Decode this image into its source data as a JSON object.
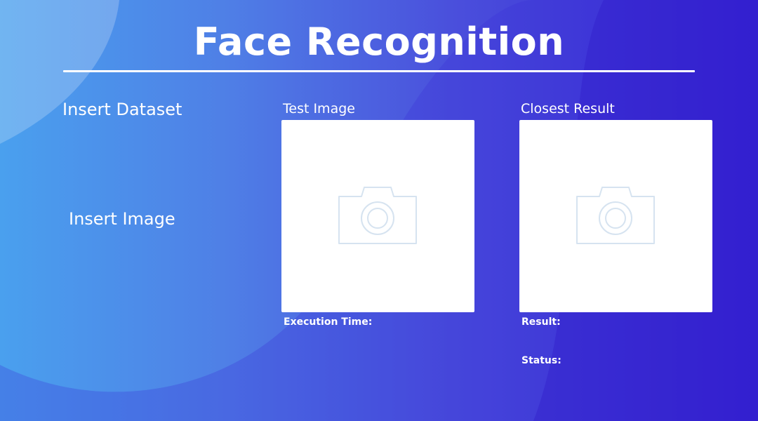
{
  "app": {
    "title": "Face Recognition"
  },
  "controls": {
    "insert_dataset_label": "Insert Dataset",
    "insert_image_label": "Insert Image"
  },
  "panels": {
    "test_image": {
      "label": "Test Image",
      "placeholder_icon": "camera-icon"
    },
    "closest_result": {
      "label": "Closest Result",
      "placeholder_icon": "camera-icon"
    }
  },
  "info": {
    "execution_time_label": "Execution Time:",
    "result_label": "Result:",
    "status_label": "Status:"
  },
  "colors": {
    "gradient_start": "#4aa0ee",
    "gradient_end": "#3620d2",
    "icon_stroke": "#d6e3f0",
    "panel_background": "#ffffff"
  }
}
